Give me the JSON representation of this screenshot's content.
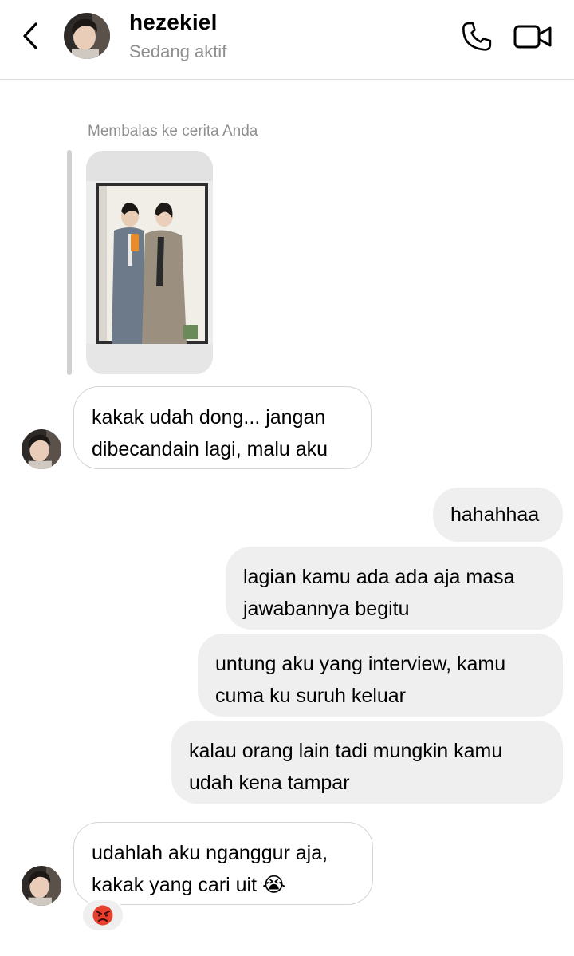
{
  "header": {
    "name": "hezekiel",
    "status": "Sedang aktif"
  },
  "reply": {
    "label": "Membalas ke cerita Anda"
  },
  "messages": [
    {
      "side": "in",
      "lines": [
        "kakak udah dong... jangan",
        "dibecandain lagi, malu aku"
      ]
    },
    {
      "side": "out",
      "lines": [
        "hahahhaa"
      ]
    },
    {
      "side": "out",
      "lines": [
        "lagian kamu ada ada aja masa",
        "jawabannya begitu"
      ]
    },
    {
      "side": "out",
      "lines": [
        "untung aku yang interview, kamu",
        "cuma ku suruh keluar"
      ]
    },
    {
      "side": "out",
      "lines": [
        "kalau orang lain tadi mungkin kamu",
        "udah kena tampar"
      ]
    },
    {
      "side": "in",
      "lines": [
        "udahlah aku nganggur aja,",
        "kakak yang cari uit 😭"
      ]
    }
  ],
  "reaction": {
    "emoji": "😡"
  },
  "icons": [
    "back-icon",
    "phone-icon",
    "video-call-icon"
  ]
}
